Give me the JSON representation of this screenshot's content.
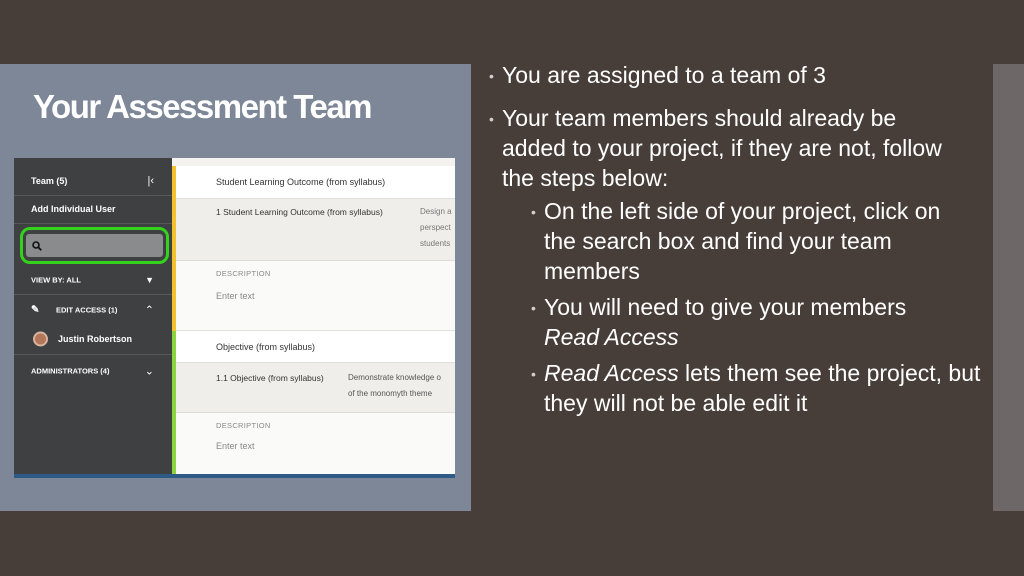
{
  "slide": {
    "title": "Your Assessment Team",
    "bullets": [
      {
        "text": "You are assigned to a team of 3"
      },
      {
        "text": "Your team members should already be added to your project, if they are not, follow the steps below:"
      }
    ],
    "sub_bullets": [
      {
        "text": "On the left side of your project, click on the search box and find your team members"
      },
      {
        "text_plain": "You will need to give your members",
        "text_italic": "Read Access"
      },
      {
        "text_italic": "Read Access",
        "text_plain": "lets them see the project, but they will not be able edit it"
      }
    ]
  },
  "screenshot": {
    "sidebar": {
      "team_label": "Team (5)",
      "collapse_icon": "collapse-left-icon",
      "add_user_label": "Add Individual User",
      "search_placeholder": "",
      "view_by_label": "VIEW BY: ALL",
      "edit_access_label": "EDIT ACCESS (1)",
      "user_name": "Justin Robertson",
      "administrators_label": "ADMINISTRATORS (4)"
    },
    "content": {
      "slo_header": "Student Learning Outcome (from syllabus)",
      "slo_row_label": "1 Student Learning Outcome (from syllabus)",
      "slo_row_value_lines": [
        "Design a",
        "perspect",
        "students"
      ],
      "description_label_1": "DESCRIPTION",
      "enter_text_1": "Enter text",
      "objective_header": "Objective (from syllabus)",
      "objective_row_label": "1.1 Objective (from syllabus)",
      "objective_row_value_1": "Demonstrate knowledge o",
      "objective_row_value_2": "of the monomyth theme",
      "description_label_2": "DESCRIPTION",
      "enter_text_2": "Enter text"
    },
    "colors": {
      "highlight_green": "#34d11e",
      "accent_yellow": "#f2c12e",
      "accent_green": "#8bd33f",
      "bottom_bar_blue": "#2d5a87"
    }
  }
}
